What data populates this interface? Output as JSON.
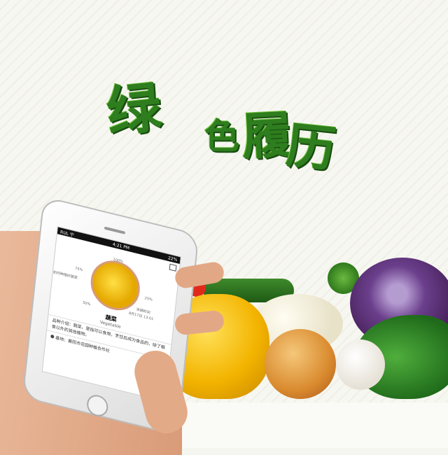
{
  "title": {
    "chars": [
      "绿",
      "色",
      "履",
      "历"
    ]
  },
  "phone": {
    "status": {
      "carrier": "RUL 宁",
      "time": "4:21 PM",
      "battery": "22%"
    },
    "trace": {
      "labels": [
        "100%",
        "75%",
        "25%",
        "50%"
      ],
      "left_note": "如何种植好蔬菜",
      "right_note": "采摘时间",
      "right_date": "8月17日 13:01"
    },
    "product": {
      "name": "蔬菜",
      "name_en": "Vegetable",
      "desc": "品种介绍：蔬菜，是指可以食用，烹饪后成为食品的，除了粮食以外的其他植物。",
      "base": "基地：襄阳市花园种植合作社"
    }
  }
}
